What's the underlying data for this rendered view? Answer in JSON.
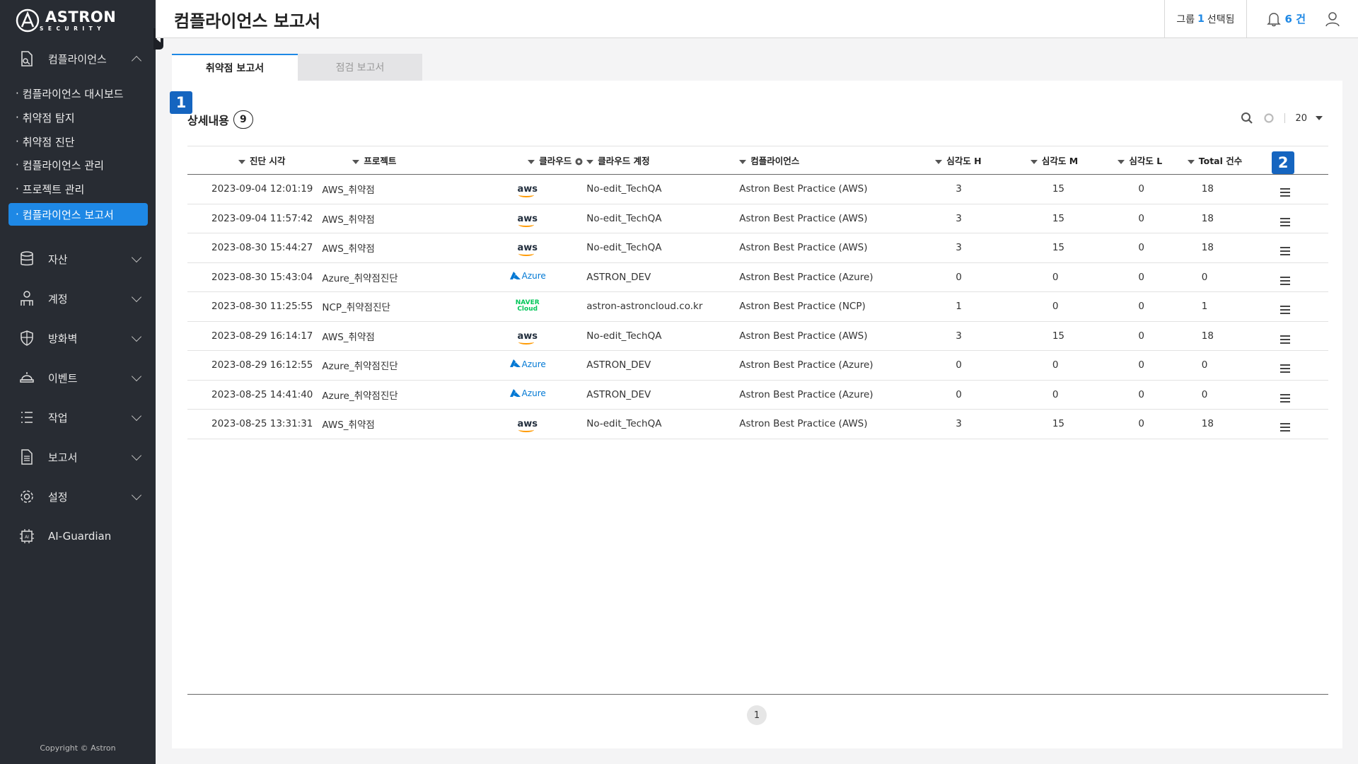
{
  "brand": {
    "name": "ASTRON",
    "sub": "SECURITY"
  },
  "sidebar": {
    "sections": [
      {
        "label": "컴플라이언스",
        "icon": "compliance-document-icon",
        "expanded": true
      },
      {
        "label": "자산",
        "icon": "database-icon"
      },
      {
        "label": "계정",
        "icon": "user-account-icon"
      },
      {
        "label": "방화벽",
        "icon": "shield-icon"
      },
      {
        "label": "이벤트",
        "icon": "alarm-icon"
      },
      {
        "label": "작업",
        "icon": "task-list-icon"
      },
      {
        "label": "보고서",
        "icon": "report-icon"
      },
      {
        "label": "설정",
        "icon": "gear-icon"
      },
      {
        "label": "AI-Guardian",
        "icon": "ai-chip-icon"
      }
    ],
    "sub_items": [
      {
        "label": "컴플라이언스 대시보드"
      },
      {
        "label": "취약점 탐지"
      },
      {
        "label": "취약점 진단"
      },
      {
        "label": "컴플라이언스 관리"
      },
      {
        "label": "프로젝트 관리"
      },
      {
        "label": "컴플라이언스 보고서",
        "active": true
      }
    ],
    "copyright": "Copyright © Astron"
  },
  "header": {
    "title": "컴플라이언스 보고서",
    "group_prefix": "그룹",
    "group_count": "1",
    "group_suffix": "선택됨",
    "notification_count": "6 건"
  },
  "tabs": [
    {
      "label": "취약점 보고서",
      "active": true
    },
    {
      "label": "점검 보고서",
      "active": false
    }
  ],
  "annotations": [
    "1",
    "2"
  ],
  "section": {
    "title": "상세내용",
    "count": "9",
    "page_size": "20"
  },
  "table": {
    "columns": [
      "진단 시각",
      "프로젝트",
      "클라우드",
      "클라우드 계정",
      "컴플라이언스",
      "심각도 H",
      "심각도 M",
      "심각도 L",
      "Total 건수"
    ],
    "rows": [
      {
        "time": "2023-09-04 12:01:19",
        "project": "AWS_취약점",
        "cloud": "aws",
        "account": "No-edit_TechQA",
        "compliance": "Astron Best Practice (AWS)",
        "h": "3",
        "m": "15",
        "l": "0",
        "total": "18"
      },
      {
        "time": "2023-09-04 11:57:42",
        "project": "AWS_취약점",
        "cloud": "aws",
        "account": "No-edit_TechQA",
        "compliance": "Astron Best Practice (AWS)",
        "h": "3",
        "m": "15",
        "l": "0",
        "total": "18"
      },
      {
        "time": "2023-08-30 15:44:27",
        "project": "AWS_취약점",
        "cloud": "aws",
        "account": "No-edit_TechQA",
        "compliance": "Astron Best Practice (AWS)",
        "h": "3",
        "m": "15",
        "l": "0",
        "total": "18"
      },
      {
        "time": "2023-08-30 15:43:04",
        "project": "Azure_취약점진단",
        "cloud": "Azure",
        "account": "ASTRON_DEV",
        "compliance": "Astron Best Practice (Azure)",
        "h": "0",
        "m": "0",
        "l": "0",
        "total": "0"
      },
      {
        "time": "2023-08-30 11:25:55",
        "project": "NCP_취약점진단",
        "cloud": "NAVER Cloud",
        "account": "astron-astroncloud.co.kr",
        "compliance": "Astron Best Practice (NCP)",
        "h": "1",
        "m": "0",
        "l": "0",
        "total": "1"
      },
      {
        "time": "2023-08-29 16:14:17",
        "project": "AWS_취약점",
        "cloud": "aws",
        "account": "No-edit_TechQA",
        "compliance": "Astron Best Practice (AWS)",
        "h": "3",
        "m": "15",
        "l": "0",
        "total": "18"
      },
      {
        "time": "2023-08-29 16:12:55",
        "project": "Azure_취약점진단",
        "cloud": "Azure",
        "account": "ASTRON_DEV",
        "compliance": "Astron Best Practice (Azure)",
        "h": "0",
        "m": "0",
        "l": "0",
        "total": "0"
      },
      {
        "time": "2023-08-25 14:41:40",
        "project": "Azure_취약점진단",
        "cloud": "Azure",
        "account": "ASTRON_DEV",
        "compliance": "Astron Best Practice (Azure)",
        "h": "0",
        "m": "0",
        "l": "0",
        "total": "0"
      },
      {
        "time": "2023-08-25 13:31:31",
        "project": "AWS_취약점",
        "cloud": "aws",
        "account": "No-edit_TechQA",
        "compliance": "Astron Best Practice (AWS)",
        "h": "3",
        "m": "15",
        "l": "0",
        "total": "18"
      }
    ]
  },
  "pagination": {
    "current": "1"
  },
  "colors": {
    "accent": "#1e88e5",
    "sidebar_bg": "#282c33",
    "annotation": "#1565c0"
  }
}
